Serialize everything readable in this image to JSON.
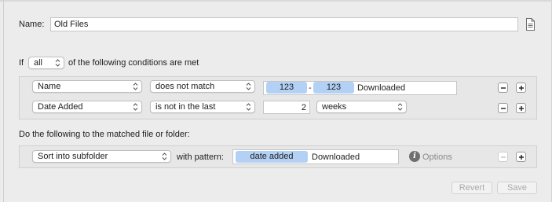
{
  "name_row": {
    "label": "Name:",
    "value": "Old Files",
    "icon": "document-icon"
  },
  "conditions": {
    "prefix": "If",
    "match_mode": "all",
    "suffix": "of the following conditions are met",
    "rows": [
      {
        "attribute": "Name",
        "operator": "does not match",
        "pattern_tokens": [
          "123",
          "123"
        ],
        "pattern_separator": "-",
        "pattern_text": "Downloaded"
      },
      {
        "attribute": "Date Added",
        "operator": "is not in the last",
        "amount": "2",
        "unit": "weeks"
      }
    ]
  },
  "actions": {
    "heading": "Do the following to the matched file or folder:",
    "rows": [
      {
        "action": "Sort into subfolder",
        "pattern_label": "with pattern:",
        "token": "date added",
        "pattern_text": "Downloaded",
        "options_label": "Options"
      }
    ]
  },
  "footer": {
    "revert_label": "Revert",
    "save_label": "Save"
  }
}
